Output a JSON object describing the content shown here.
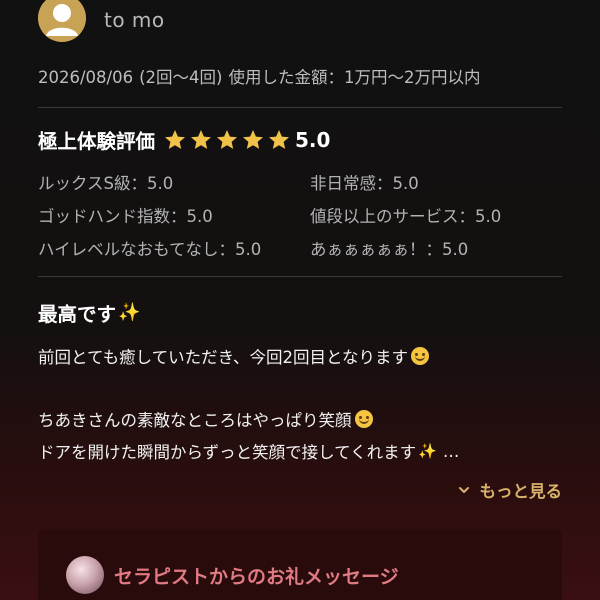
{
  "user": {
    "name": "to mo",
    "avatar_icon": "user-avatar-icon",
    "avatar_color": "#c8a255"
  },
  "meta": {
    "date": "2026/08/06",
    "visits": "(2回〜4回)",
    "spend_label": "使用した金額：1万円〜2万円以内"
  },
  "rating": {
    "title": "極上体験評価",
    "score": "5.0",
    "stars": 5,
    "star_color": "#f0c24a"
  },
  "criteria": [
    {
      "label": "ルックスS級：5.0"
    },
    {
      "label": "非日常感：5.0"
    },
    {
      "label": "ゴッドハンド指数：5.0"
    },
    {
      "label": "値段以上のサービス：5.0"
    },
    {
      "label": "ハイレベルなおもてなし：5.0"
    },
    {
      "label": "あぁぁぁぁぁ！：5.0"
    }
  ],
  "review": {
    "title": "最高です",
    "lines": [
      "前回とても癒していただき、今回2回目となります",
      "ちあきさんの素敵なところはやっぱり笑顔",
      "ドアを開けた瞬間からずっと笑顔で接してくれます"
    ],
    "ellipsis": "…"
  },
  "more_label": "もっと見る",
  "thanks": {
    "title": "セラピストからのお礼メッセージ"
  },
  "colors": {
    "accent_gold": "#d7b06a",
    "accent_pink": "#e07a83"
  }
}
